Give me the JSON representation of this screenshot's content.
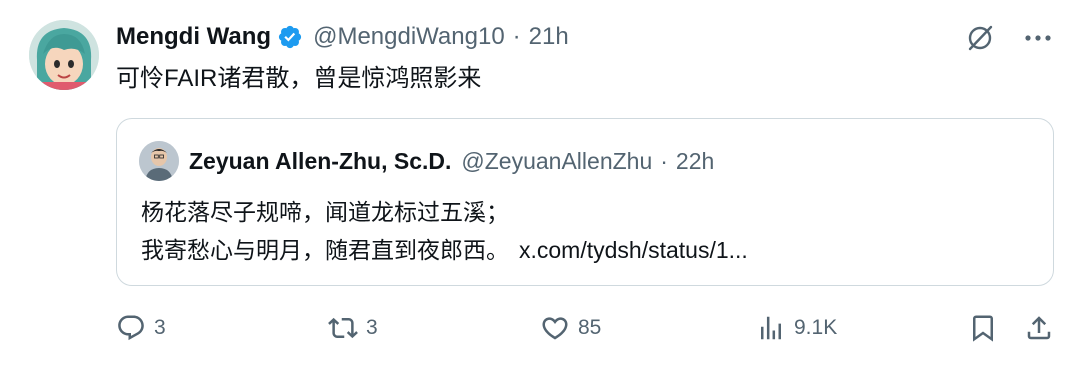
{
  "author": {
    "name": "Mengdi Wang",
    "handle": "@MengdiWang10",
    "separator": "·",
    "time": "21h",
    "verified": true
  },
  "tweet": {
    "text": "可怜FAIR诸君散，曾是惊鸿照影来"
  },
  "quoted": {
    "name": "Zeyuan Allen-Zhu, Sc.D.",
    "handle": "@ZeyuanAllenZhu",
    "separator": "·",
    "time": "22h",
    "line1": "杨花落尽子规啼，闻道龙标过五溪；",
    "line2": "我寄愁心与明月，随君直到夜郎西。",
    "link": "x.com/tydsh/status/1..."
  },
  "metrics": {
    "replies": "3",
    "reposts": "3",
    "likes": "85",
    "views": "9.1K"
  },
  "icons": {
    "verified": "verified-badge-icon",
    "grok": "grok-icon",
    "more": "more-icon",
    "reply": "reply-icon",
    "repost": "repost-icon",
    "like": "like-icon",
    "views": "views-icon",
    "bookmark": "bookmark-icon",
    "share": "share-icon"
  },
  "colors": {
    "text": "#0f1419",
    "secondary": "#536471",
    "verified": "#1d9bf0",
    "border": "#cfd9de"
  }
}
